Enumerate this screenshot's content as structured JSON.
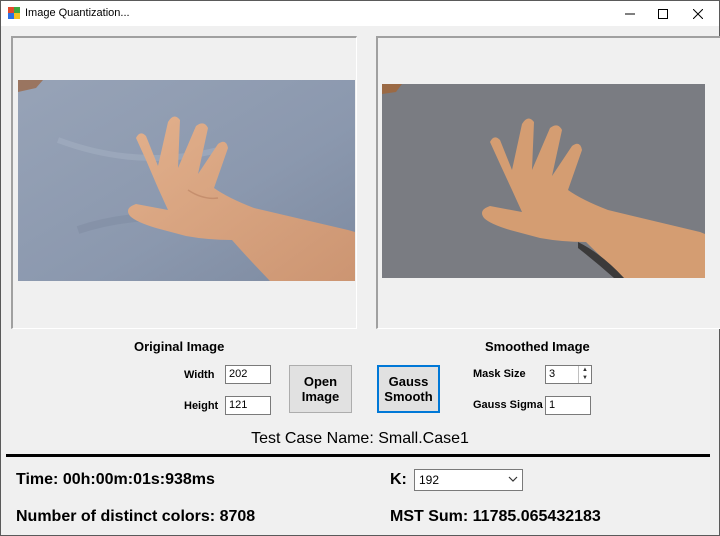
{
  "window": {
    "title": "Image Quantization..."
  },
  "images": {
    "original_caption": "Original Image",
    "smoothed_caption": "Smoothed Image"
  },
  "image_info": {
    "width_label": "Width",
    "width_value": "202",
    "height_label": "Height",
    "height_value": "121"
  },
  "buttons": {
    "open_image": "Open Image",
    "gauss_smooth": "Gauss Smooth"
  },
  "smoothing": {
    "mask_size_label": "Mask Size",
    "mask_size_value": "3",
    "gauss_sigma_label": "Gauss Sigma",
    "gauss_sigma_value": "1"
  },
  "test_case": {
    "text": "Test Case Name: Small.Case1"
  },
  "results": {
    "time": "Time: 00h:00m:01s:938ms",
    "distinct_colors": "Number of distinct colors: 8708",
    "k_label": "K:",
    "k_value": "192",
    "mst_sum": "MST Sum: 11785.065432183"
  },
  "colors": {
    "cloth": "#8f9cb2",
    "skin": "#d8a07a",
    "smoothed_bg": "#7a7c82",
    "smoothed_skin": "#d49d72"
  }
}
